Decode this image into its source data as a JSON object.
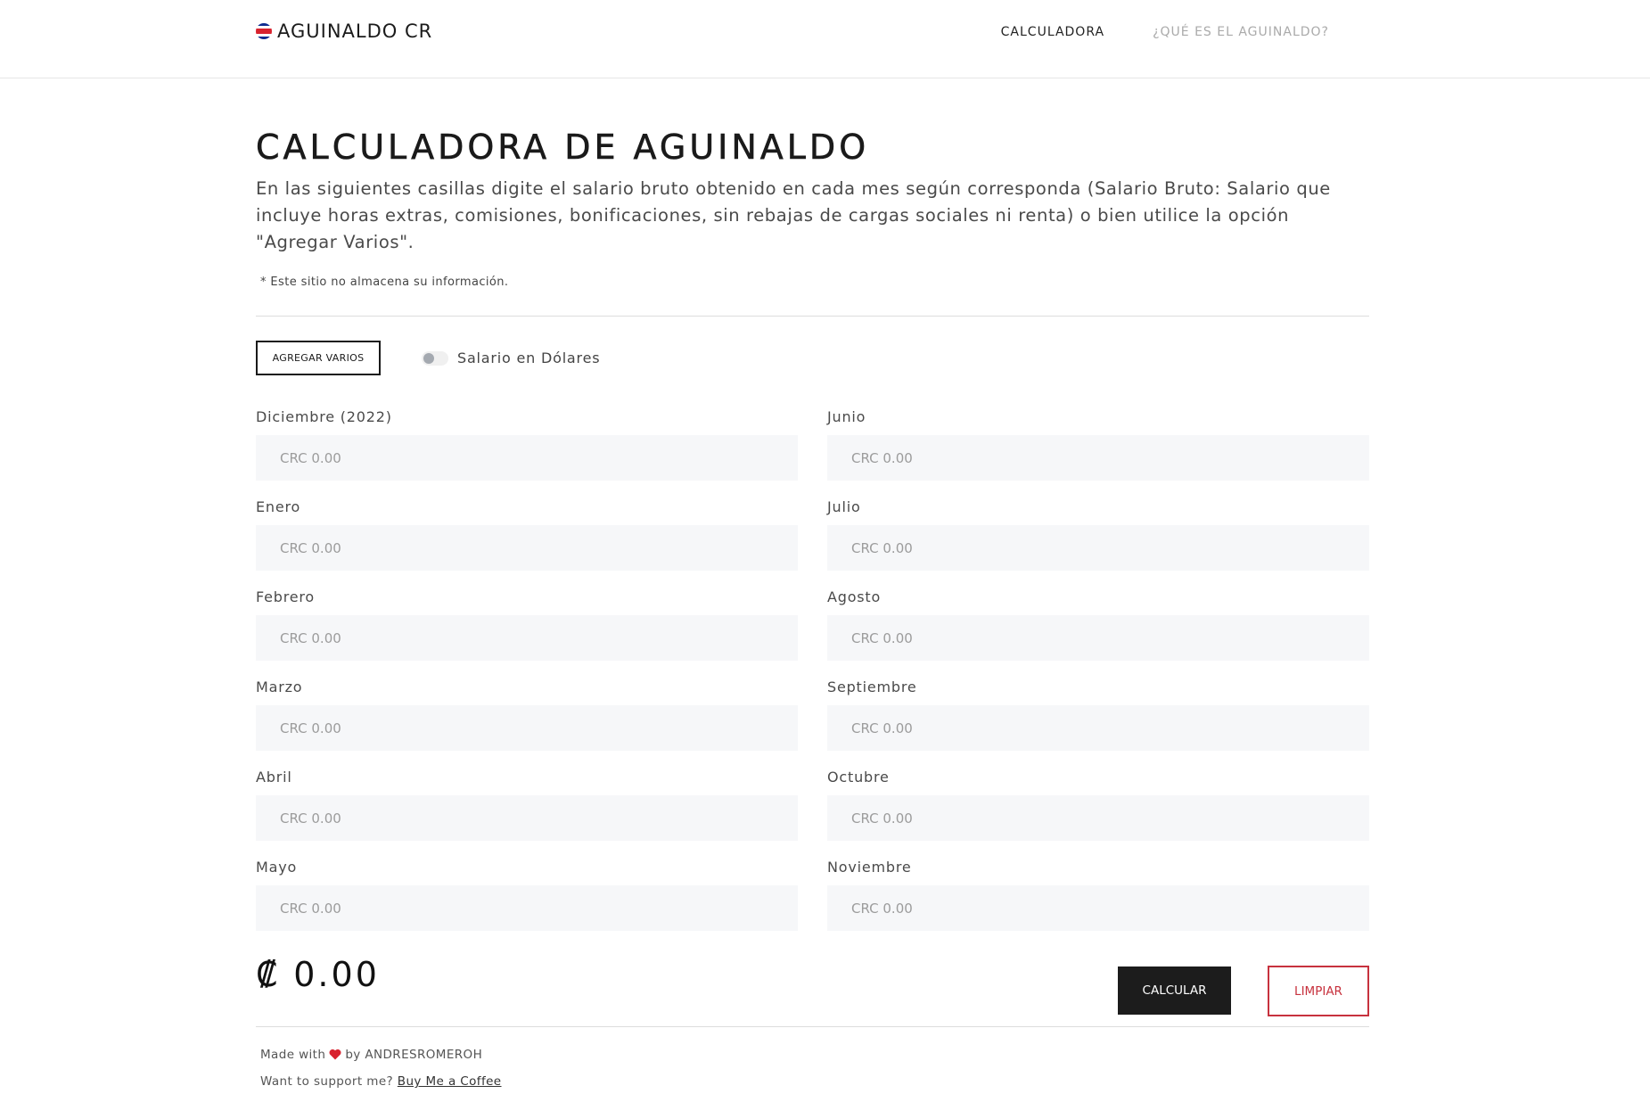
{
  "header": {
    "brand": "AGUINALDO CR",
    "brand_icon": "costa-rica-flag-icon",
    "nav": [
      {
        "label": "CALCULADORA",
        "active": true
      },
      {
        "label": "¿QUÉ ES EL AGUINALDO?",
        "active": false
      }
    ]
  },
  "main": {
    "title": "CALCULADORA DE AGUINALDO",
    "intro": "En las siguientes casillas digite el salario bruto obtenido en cada mes según corresponda (Salario Bruto: Salario que incluye horas extras, comisiones, bonificaciones, sin rebajas de cargas sociales ni renta) o bien utilice la opción \"Agregar Varios\".",
    "privacy_note": "* Este sitio no almacena su información.",
    "agregar_label": "AGREGAR VARIOS",
    "toggle_label": "Salario en Dólares",
    "toggle_on": false,
    "placeholder": "CRC 0.00",
    "months_left": [
      {
        "label": "Diciembre (2022)",
        "value": ""
      },
      {
        "label": "Enero",
        "value": ""
      },
      {
        "label": "Febrero",
        "value": ""
      },
      {
        "label": "Marzo",
        "value": ""
      },
      {
        "label": "Abril",
        "value": ""
      },
      {
        "label": "Mayo",
        "value": ""
      }
    ],
    "months_right": [
      {
        "label": "Junio",
        "value": ""
      },
      {
        "label": "Julio",
        "value": ""
      },
      {
        "label": "Agosto",
        "value": ""
      },
      {
        "label": "Septiembre",
        "value": ""
      },
      {
        "label": "Octubre",
        "value": ""
      },
      {
        "label": "Noviembre",
        "value": ""
      }
    ],
    "total": "₡ 0.00",
    "calcular_label": "CALCULAR",
    "limpiar_label": "LIMPIAR"
  },
  "footer": {
    "made_with": "Made with",
    "by": "by ANDRESROMEROH",
    "support": "Want to support me?",
    "coffee_link": "Buy Me a Coffee"
  },
  "colors": {
    "accent_red": "#c7323e",
    "dark": "#1c1c1c",
    "input_bg": "#f6f7f9"
  }
}
